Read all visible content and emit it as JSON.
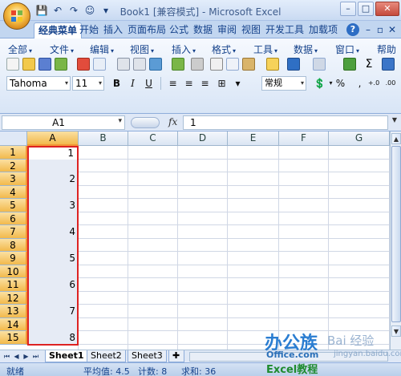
{
  "window": {
    "title": "Book1  [兼容模式] - Microsoft Excel",
    "min": "–",
    "max": "□",
    "close": "✕"
  },
  "quick_access": [
    "💾",
    "↶",
    "↷",
    "☺",
    "▾"
  ],
  "ribbon_tabs": [
    {
      "label": "经典菜单",
      "active": true
    },
    {
      "label": "开始"
    },
    {
      "label": "插入"
    },
    {
      "label": "页面布局"
    },
    {
      "label": "公式"
    },
    {
      "label": "数据"
    },
    {
      "label": "审阅"
    },
    {
      "label": "视图"
    },
    {
      "label": "开发工具"
    },
    {
      "label": "加载项"
    }
  ],
  "ribbon_extra": {
    "help": "?",
    "minimize": "–",
    "restore": "▫",
    "close": "✕"
  },
  "menus": [
    {
      "label": "全部"
    },
    {
      "label": "文件"
    },
    {
      "label": "编辑"
    },
    {
      "label": "视图"
    },
    {
      "label": "插入"
    },
    {
      "label": "格式"
    },
    {
      "label": "工具"
    },
    {
      "label": "数据"
    },
    {
      "label": "窗口"
    },
    {
      "label": "帮助"
    }
  ],
  "font": {
    "name": "Tahoma",
    "size": "11",
    "number_format": "常规",
    "bold": "B",
    "italic": "I",
    "underline": "U",
    "percent": "%",
    "comma": ",",
    "inc_decimal": "+.0",
    "dec_decimal": ".00"
  },
  "formula_bar": {
    "name_box": "A1",
    "fx": "fx",
    "value": "1"
  },
  "columns": [
    "A",
    "B",
    "C",
    "D",
    "E",
    "F",
    "G"
  ],
  "rows": [
    "1",
    "2",
    "3",
    "4",
    "5",
    "6",
    "7",
    "8",
    "9",
    "10",
    "11",
    "12",
    "13",
    "14",
    "15"
  ],
  "cells_A": [
    "1",
    "",
    "2",
    "",
    "3",
    "",
    "4",
    "",
    "5",
    "",
    "6",
    "",
    "7",
    "",
    "8"
  ],
  "sheets": [
    {
      "label": "Sheet1",
      "active": true
    },
    {
      "label": "Sheet2"
    },
    {
      "label": "Sheet3"
    }
  ],
  "status": {
    "mode": "就绪",
    "average": "平均值: 4.5",
    "count": "计数: 8",
    "sum": "求和: 36"
  },
  "watermark": {
    "brand": "办公族",
    "site": "Office.com",
    "baidu": "Bai 经验",
    "url": "jingyan.baidu.com",
    "tag": "Excel教程"
  },
  "colors": {
    "selection_border": "#dd2222",
    "header_selected": "#f2b94c",
    "ribbon_text": "#15428b"
  }
}
